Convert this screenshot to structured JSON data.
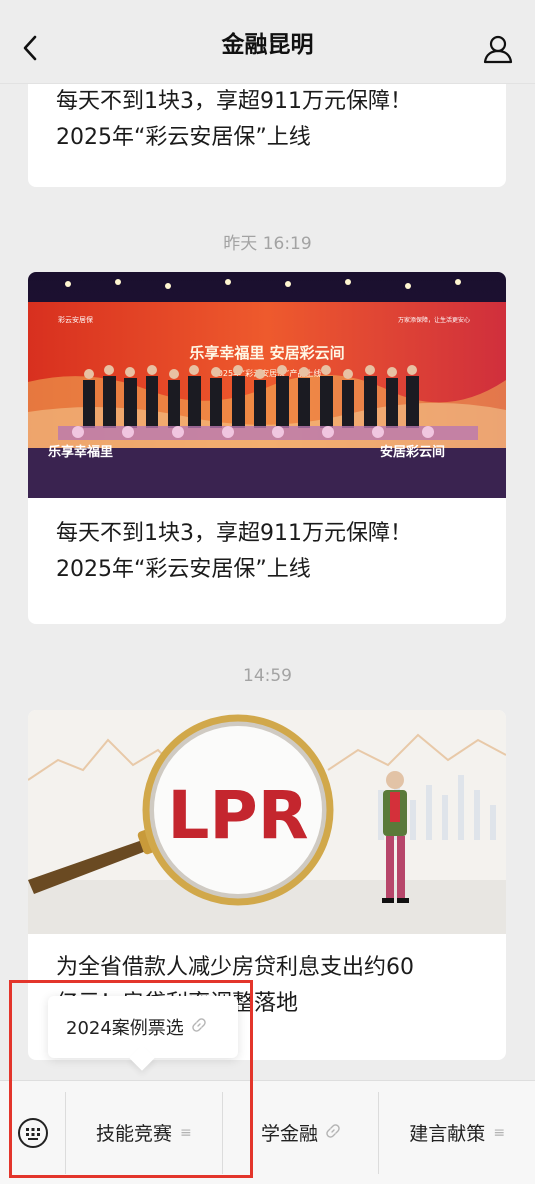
{
  "header": {
    "title": "金融昆明",
    "back_icon": "chevron-left-icon",
    "profile_icon": "user-icon"
  },
  "feed": [
    {
      "title_line1": "每天不到1块3，享超911万元保障！",
      "title_line2": "2025年“彩云安居保”上线"
    },
    {
      "time": "昨天 16:19",
      "image": {
        "stage_title": "乐享幸福里 安居彩云间",
        "stage_subtitle": "2025年“彩云安居保”产品上线",
        "left_sign": "乐享幸福里",
        "right_sign": "安居彩云间",
        "logo_text": "彩云安居保",
        "banner_right": "万家添保障，让生活更安心"
      },
      "title_line1": "每天不到1块3，享超911万元保障！",
      "title_line2": "2025年“彩云安居保”上线"
    },
    {
      "time": "14:59",
      "image": {
        "lens_text": "LPR"
      },
      "title_line1": "为全省借款人减少房贷利息支出约60",
      "title_line2": "亿元！房贷利率调整落地"
    }
  ],
  "popup": {
    "label": "2024案例票选",
    "icon": "link-icon"
  },
  "menu": {
    "keyboard_icon": "keyboard-icon",
    "items": [
      {
        "label": "技能竞赛",
        "suffix": "≡",
        "icon": "menu-icon"
      },
      {
        "label": "学金融",
        "suffix": "🔗",
        "icon": "link-icon"
      },
      {
        "label": "建言献策",
        "suffix": "≡",
        "icon": "menu-icon"
      }
    ]
  },
  "colors": {
    "background": "#ededed",
    "card": "#ffffff",
    "highlight": "#e3352b",
    "timestamp": "#a3a3a3"
  }
}
